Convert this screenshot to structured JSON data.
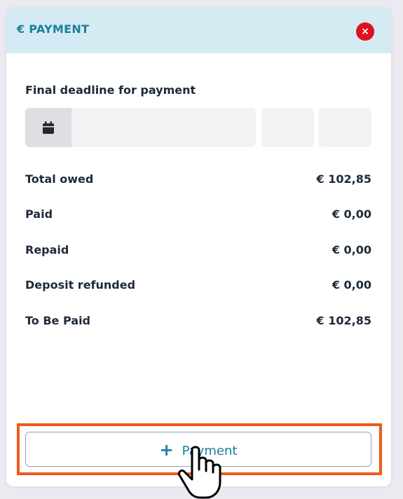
{
  "header": {
    "title": "€ PAYMENT",
    "close_glyph": "×",
    "close_color": "#e0101f",
    "accent_color": "#1c7f9a",
    "background_color": "#d4ebf4"
  },
  "deadline": {
    "label": "Final deadline for payment",
    "date_value": "",
    "hour_value": "",
    "minute_value": "",
    "icon": "calendar-icon"
  },
  "summary": {
    "rows": [
      {
        "label": "Total owed",
        "value": "€ 102,85"
      },
      {
        "label": "Paid",
        "value": "€ 0,00"
      },
      {
        "label": "Repaid",
        "value": "€ 0,00"
      },
      {
        "label": "Deposit refunded",
        "value": "€ 0,00"
      },
      {
        "label": "To Be Paid",
        "value": "€ 102,85"
      }
    ]
  },
  "actions": {
    "add_payment_plus": "+",
    "add_payment_label": "Payment",
    "highlight_color": "#f05a1a"
  },
  "pointer": {
    "icon": "hand-pointer-icon"
  }
}
